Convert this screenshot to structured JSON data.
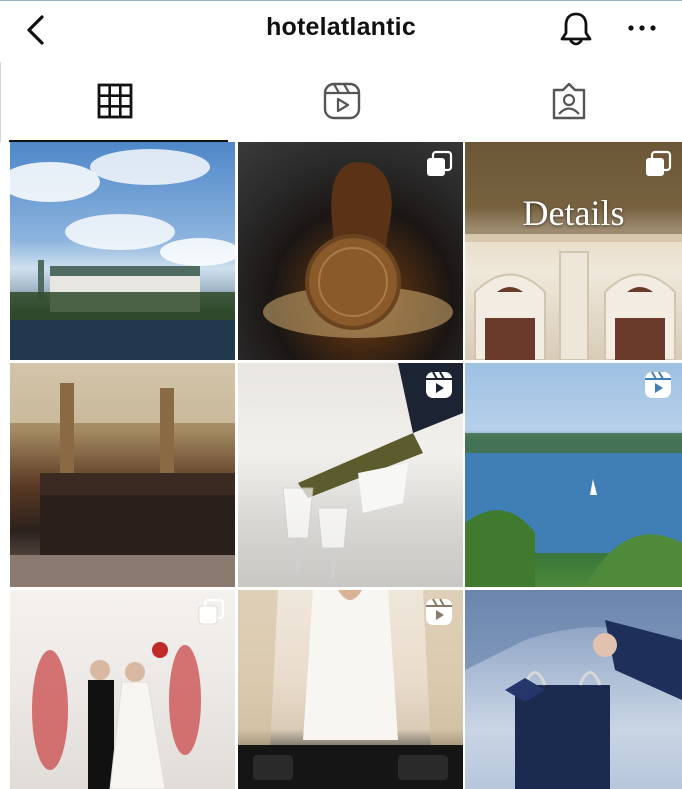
{
  "header": {
    "title": "hotelatlantic",
    "icons": {
      "back": "chevron-left-icon",
      "notifications": "bell-icon",
      "more": "more-horizontal-icon"
    }
  },
  "tabs": [
    {
      "id": "posts",
      "icon": "grid-icon",
      "active": true
    },
    {
      "id": "reels",
      "icon": "reels-icon",
      "active": false
    },
    {
      "id": "tagged",
      "icon": "tagged-user-icon",
      "active": false
    }
  ],
  "grid": [
    {
      "id": "post-1",
      "badge": null
    },
    {
      "id": "post-2",
      "badge": "carousel-icon"
    },
    {
      "id": "post-3",
      "badge": "carousel-icon",
      "overlay_text": "Details"
    },
    {
      "id": "post-4",
      "badge": null
    },
    {
      "id": "post-5",
      "badge": "reel-icon"
    },
    {
      "id": "post-6",
      "badge": "reel-icon"
    },
    {
      "id": "post-7",
      "badge": "carousel-icon"
    },
    {
      "id": "post-8",
      "badge": "reel-icon"
    },
    {
      "id": "post-9",
      "badge": null
    }
  ],
  "colors": {
    "text": "#111111",
    "background": "#ffffff",
    "divider": "#cfd6dd"
  }
}
